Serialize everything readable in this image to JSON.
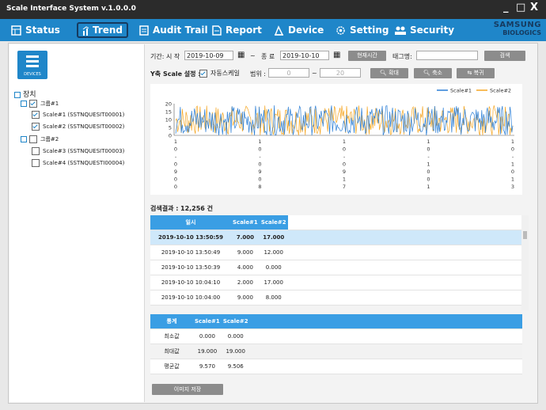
{
  "window": {
    "title": "Scale Interface System v.1.0.0.0",
    "controls": [
      "_",
      "□",
      "X"
    ]
  },
  "menu": {
    "items": [
      {
        "label": "Status",
        "icon": "status-icon"
      },
      {
        "label": "Trend",
        "icon": "trend-icon",
        "active": true
      },
      {
        "label": "Audit Trail",
        "icon": "audit-trail-icon"
      },
      {
        "label": "Report",
        "icon": "report-icon"
      },
      {
        "label": "Device",
        "icon": "device-icon"
      },
      {
        "label": "Setting",
        "icon": "gear-icon"
      },
      {
        "label": "Security",
        "icon": "users-icon"
      }
    ],
    "brand_line1": "SAMSUNG",
    "brand_line2": "BIOLOGICS"
  },
  "sidebar": {
    "devices_label": "DEVICES",
    "root": "장치",
    "groups": [
      {
        "name": "그룹#1",
        "checked": true,
        "items": [
          {
            "label": "Scale#1 (SSTNQUESIT00001)",
            "checked": true
          },
          {
            "label": "Scale#2 (SSTNQUESIT00002)",
            "checked": true
          }
        ]
      },
      {
        "name": "그룹#2",
        "checked": false,
        "items": [
          {
            "label": "Scale#3 (SSTNQUESIT00003)",
            "checked": false
          },
          {
            "label": "Scale#4 (SSTNQUESTI00004)",
            "checked": false
          }
        ]
      }
    ]
  },
  "filters": {
    "period_label": "기간: 시 작",
    "start_date": "2019-10-09",
    "tilde": "~",
    "end_label": "종 료",
    "end_date": "2019-10-10",
    "now_button": "현재시간",
    "tag_label": "태그명:",
    "tag_value": "",
    "search_button": "검색",
    "yscale_label": "Y축 Scale 설정 :",
    "autoscale_label": "자동스케일",
    "autoscale_checked": true,
    "range_label": "범위 :",
    "range_min": "0",
    "range_max": "20",
    "zoom_in": "확대",
    "zoom_out": "축소",
    "restore": "복귀"
  },
  "chart_data": {
    "type": "line",
    "ylim": [
      0,
      20
    ],
    "yticks": [
      "20",
      "15",
      "10",
      "5",
      "0"
    ],
    "xtick_labels": [
      [
        "1",
        "0",
        "-",
        "0",
        "9",
        "0",
        "0"
      ],
      [
        "1",
        "0",
        "-",
        "0",
        "9",
        "0",
        "8"
      ],
      [
        "1",
        "0",
        "-",
        "0",
        "9",
        "1",
        "7"
      ],
      [
        "1",
        "0",
        "-",
        "1",
        "0",
        "0",
        "1"
      ],
      [
        "1",
        "0",
        "-",
        "1",
        "0",
        "1",
        "3"
      ]
    ],
    "series": [
      {
        "name": "Scale#1",
        "color": "#2a7ed6"
      },
      {
        "name": "Scale#2",
        "color": "#f5a623"
      }
    ]
  },
  "results": {
    "label": "검색결과 :",
    "count": "12,256 건"
  },
  "grid": {
    "headers": [
      "일시",
      "Scale#1",
      "Scale#2"
    ],
    "rows": [
      [
        "2019-10-10 13:50:59",
        "7.000",
        "17.000"
      ],
      [
        "2019-10-10 13:50:49",
        "9.000",
        "12.000"
      ],
      [
        "2019-10-10 13:50:39",
        "4.000",
        "0.000"
      ],
      [
        "2019-10-10 10:04:10",
        "2.000",
        "17.000"
      ],
      [
        "2019-10-10 10:04:00",
        "9.000",
        "8.000"
      ]
    ]
  },
  "stats": {
    "headers": [
      "통계",
      "Scale#1",
      "Scale#2"
    ],
    "rows": [
      [
        "최소값",
        "0.000",
        "0.000"
      ],
      [
        "최대값",
        "19.000",
        "19.000"
      ],
      [
        "평균값",
        "9.570",
        "9.506"
      ]
    ]
  },
  "save_button": "이미지 저장",
  "colors": {
    "menu": "#1f86c9",
    "header": "#3a9ee4",
    "selected_row": "#cfe8fa"
  }
}
